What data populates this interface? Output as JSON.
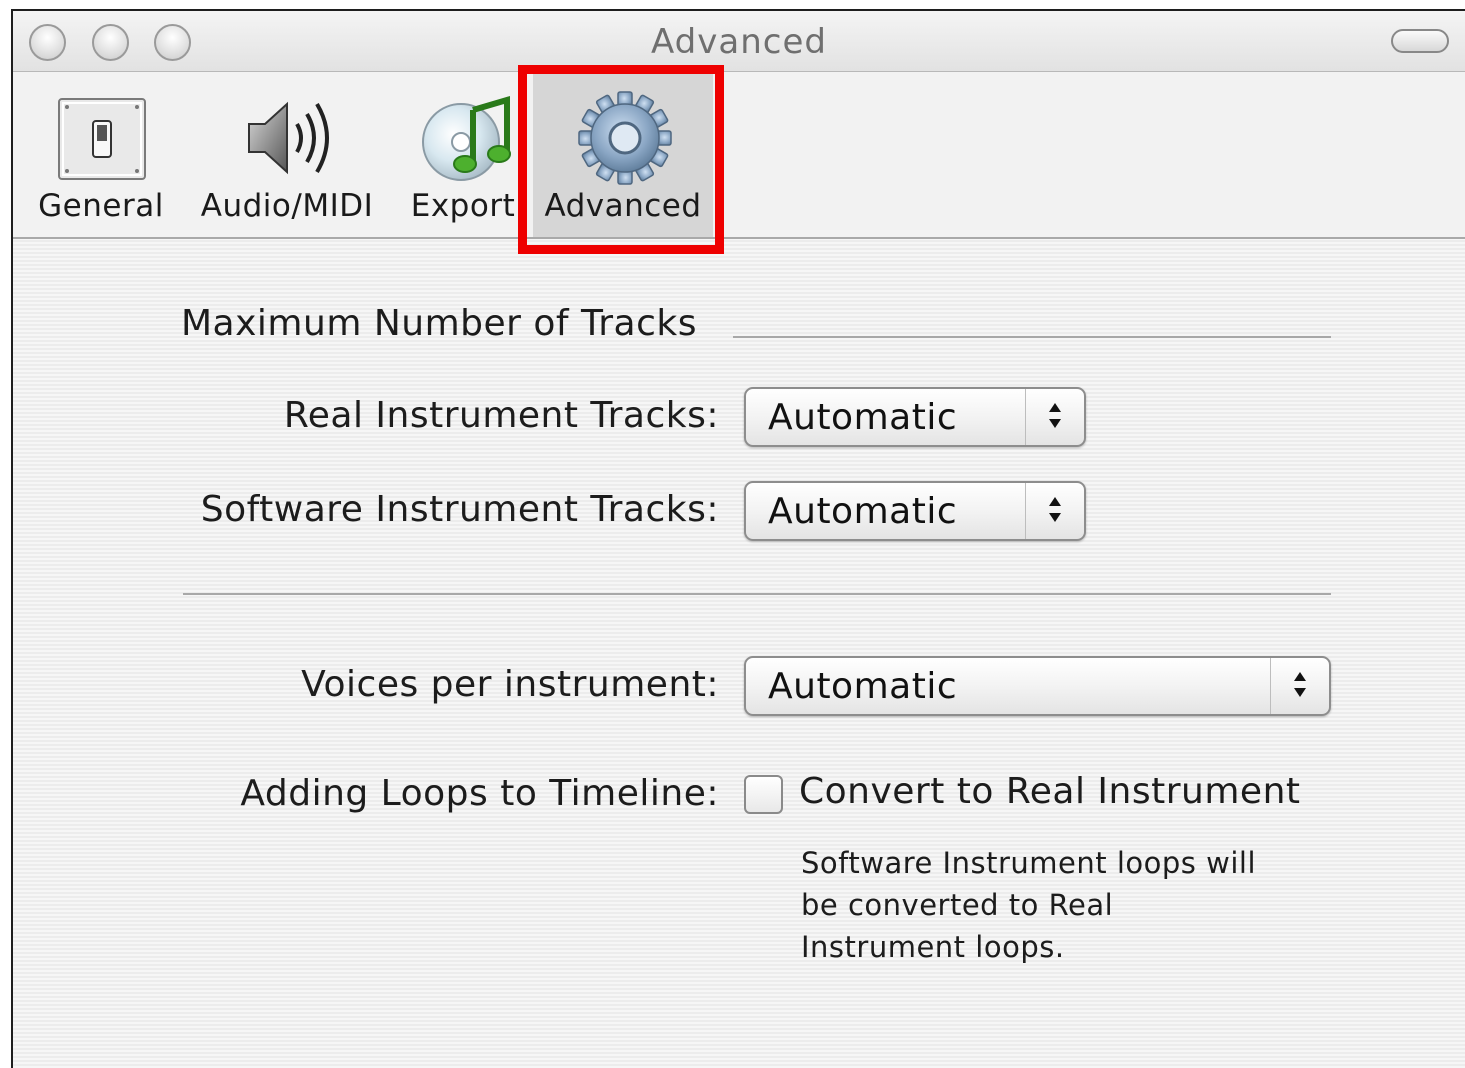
{
  "window": {
    "title": "Advanced"
  },
  "toolbar": {
    "items": [
      {
        "label": "General",
        "icon": "light-switch-icon",
        "selected": false
      },
      {
        "label": "Audio/MIDI",
        "icon": "speaker-icon",
        "selected": false
      },
      {
        "label": "Export",
        "icon": "cd-music-note-icon",
        "selected": false
      },
      {
        "label": "Advanced",
        "icon": "gear-icon",
        "selected": true
      }
    ]
  },
  "annotation": {
    "highlight_color": "#ee0000",
    "highlighted_item": "Advanced"
  },
  "settings": {
    "max_tracks_section": "Maximum Number of Tracks",
    "real_instrument": {
      "label": "Real Instrument Tracks:",
      "value": "Automatic"
    },
    "software_instrument": {
      "label": "Software Instrument Tracks:",
      "value": "Automatic"
    },
    "voices": {
      "label": "Voices per instrument:",
      "value": "Automatic"
    },
    "loops": {
      "label": "Adding Loops to Timeline:",
      "checkbox_label": "Convert to Real Instrument",
      "checked": false,
      "note": "Software Instrument loops will be converted to Real Instrument loops."
    }
  }
}
